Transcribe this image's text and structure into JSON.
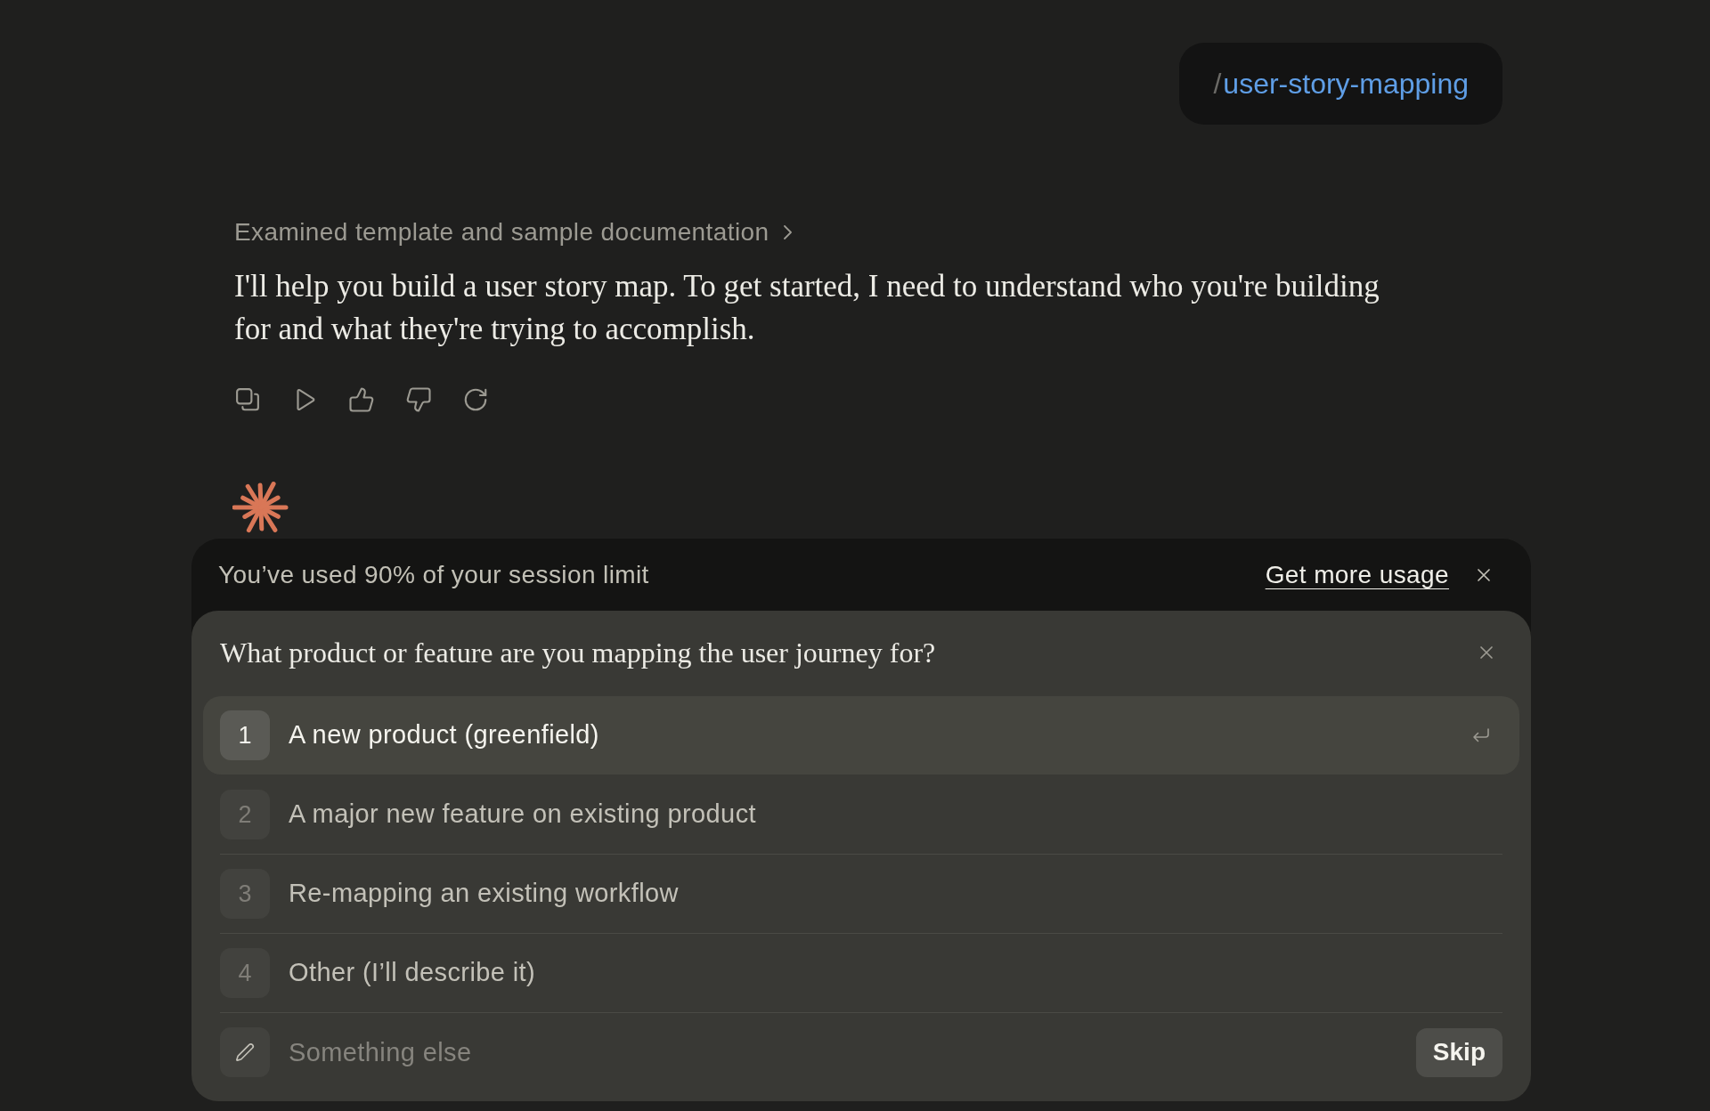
{
  "command_chip": {
    "prefix": "/",
    "command": "user-story-mapping"
  },
  "assistant_message": {
    "thinking_summary": "Examined template and sample documentation",
    "text": "I'll help you build a user story map. To get started, I need to understand who you're building for and what they're trying to accomplish."
  },
  "usage_banner": {
    "message": "You’ve used 90% of your session limit",
    "link": "Get more usage"
  },
  "question": {
    "text": "What product or feature are you mapping the user journey for?",
    "options": [
      {
        "number": "1",
        "label": "A new product (greenfield)",
        "selected": true
      },
      {
        "number": "2",
        "label": "A major new feature on existing product",
        "selected": false
      },
      {
        "number": "3",
        "label": "Re-mapping an existing workflow",
        "selected": false
      },
      {
        "number": "4",
        "label": "Other (I’ll describe it)",
        "selected": false
      }
    ],
    "custom_answer": {
      "placeholder": "Something else"
    },
    "skip": "Skip"
  }
}
